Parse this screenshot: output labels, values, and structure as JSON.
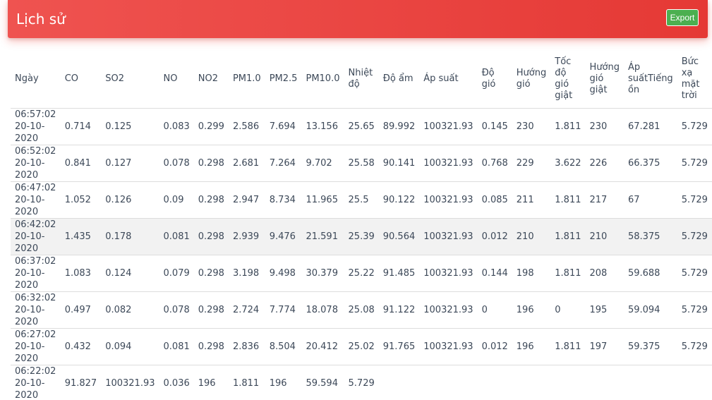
{
  "header": {
    "title": "Lịch sử",
    "export_label": "Export"
  },
  "colors": {
    "header_red": "#ef5350",
    "export_green": "#4caf50"
  },
  "table": {
    "columns": [
      "Ngày",
      "CO",
      "SO2",
      "NO",
      "NO2",
      "PM1.0",
      "PM2.5",
      "PM10.0",
      "Nhiệt độ",
      "Độ ẩm",
      "Áp suất",
      "Độ gió",
      "Hướng gió",
      "Tốc độ gió giật",
      "Hướng gió giật",
      "Áp suấtTiếng ồn",
      "Bức xạ mặt trời"
    ],
    "rows": [
      [
        "06:57:02 20-10-2020",
        "0.714",
        "0.125",
        "0.083",
        "0.299",
        "2.586",
        "7.694",
        "13.156",
        "25.65",
        "89.992",
        "100321.93",
        "0.145",
        "230",
        "1.811",
        "230",
        "67.281",
        "5.729"
      ],
      [
        "06:52:02 20-10-2020",
        "0.841",
        "0.127",
        "0.078",
        "0.298",
        "2.681",
        "7.264",
        "9.702",
        "25.58",
        "90.141",
        "100321.93",
        "0.768",
        "229",
        "3.622",
        "226",
        "66.375",
        "5.729"
      ],
      [
        "06:47:02 20-10-2020",
        "1.052",
        "0.126",
        "0.09",
        "0.298",
        "2.947",
        "8.734",
        "11.965",
        "25.5",
        "90.122",
        "100321.93",
        "0.085",
        "211",
        "1.811",
        "217",
        "67",
        "5.729"
      ],
      [
        "06:42:02 20-10-2020",
        "1.435",
        "0.178",
        "0.081",
        "0.298",
        "2.939",
        "9.476",
        "21.591",
        "25.39",
        "90.564",
        "100321.93",
        "0.012",
        "210",
        "1.811",
        "210",
        "58.375",
        "5.729"
      ],
      [
        "06:37:02 20-10-2020",
        "1.083",
        "0.124",
        "0.079",
        "0.298",
        "3.198",
        "9.498",
        "30.379",
        "25.22",
        "91.485",
        "100321.93",
        "0.144",
        "198",
        "1.811",
        "208",
        "59.688",
        "5.729"
      ],
      [
        "06:32:02 20-10-2020",
        "0.497",
        "0.082",
        "0.078",
        "0.298",
        "2.724",
        "7.774",
        "18.078",
        "25.08",
        "91.122",
        "100321.93",
        "0",
        "196",
        "0",
        "195",
        "59.094",
        "5.729"
      ],
      [
        "06:27:02 20-10-2020",
        "0.432",
        "0.094",
        "0.081",
        "0.298",
        "2.836",
        "8.504",
        "20.412",
        "25.02",
        "91.765",
        "100321.93",
        "0.012",
        "196",
        "1.811",
        "197",
        "59.375",
        "5.729"
      ],
      [
        "06:22:02 20-10-2020",
        "91.827",
        "100321.93",
        "0.036",
        "196",
        "1.811",
        "196",
        "59.594",
        "5.729"
      ]
    ]
  }
}
